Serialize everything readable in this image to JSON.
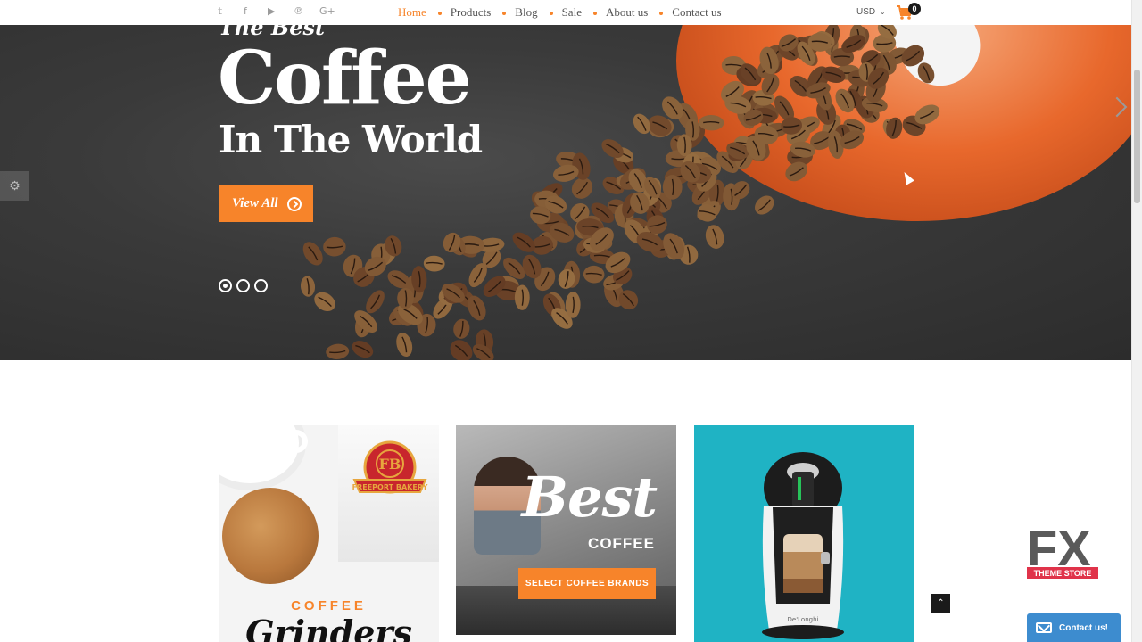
{
  "topbar": {
    "social_icons": [
      "twitter-icon",
      "facebook-icon",
      "youtube-icon",
      "pinterest-icon",
      "google-plus-icon"
    ],
    "nav": [
      {
        "label": "Home",
        "active": true
      },
      {
        "label": "Products",
        "active": false
      },
      {
        "label": "Blog",
        "active": false
      },
      {
        "label": "Sale",
        "active": false
      },
      {
        "label": "About us",
        "active": false
      },
      {
        "label": "Contact us",
        "active": false
      }
    ],
    "currency": "USD",
    "cart_count": "0"
  },
  "hero": {
    "tagline": "The Best",
    "headline": "Coffee",
    "subline": "In The World",
    "button_label": "View All",
    "slides": 3,
    "active_slide": 1
  },
  "banners": [
    {
      "logo_text": "FREEPORT BAKERY",
      "label": "COFFEE",
      "title": "Grinders"
    },
    {
      "title": "Best",
      "subtitle": "COFFEE",
      "button_label": "SELECT COFFEE BRANDS"
    },
    {
      "brand": "De'Longhi"
    }
  ],
  "widgets": {
    "fx_logo": "FX",
    "fx_sub": "THEME STORE",
    "contact_label": "Contact us!"
  },
  "colors": {
    "accent": "#f7842a",
    "teal": "#1fb3c4",
    "contact_blue": "#3d8ccf"
  }
}
